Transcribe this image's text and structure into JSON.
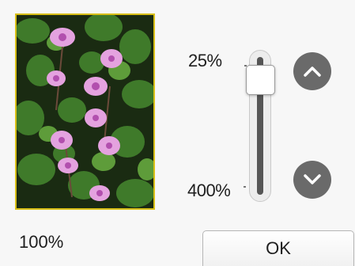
{
  "zoom": {
    "min_label": "25%",
    "max_label": "400%",
    "current": "100%",
    "level_fraction": 0.25
  },
  "controls": {
    "increase_icon": "chevron-up-icon",
    "decrease_icon": "chevron-down-icon",
    "ok_label": "OK"
  },
  "preview": {
    "content": "photo-thumbnail",
    "border_color": "#d8bf17"
  },
  "colors": {
    "round_button": "#6a6a6a",
    "slider_groove": "#555555"
  }
}
